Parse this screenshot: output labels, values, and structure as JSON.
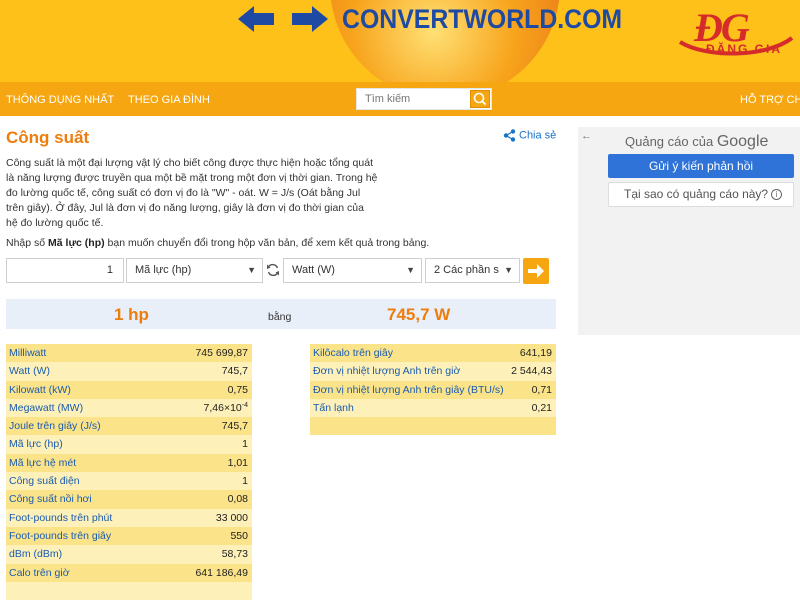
{
  "header": {
    "brand": "CONVERTWORLD.COM",
    "partner_logo_letters": "ĐG",
    "partner_logo_name": "ĐẶNG GIA"
  },
  "nav": {
    "items": [
      {
        "label": "THÔNG DỤNG NHẤT"
      },
      {
        "label": "THEO GIA ĐÌNH"
      },
      {
        "label": "HỖ TRỢ CH"
      }
    ],
    "search_placeholder": "Tìm kiếm"
  },
  "page": {
    "title": "Công suất",
    "share_label": "Chia sẻ",
    "description": "Công suất là một đại lượng vật lý cho biết công được thực hiện hoặc tổng quát là năng lượng được truyền qua một bề mặt trong một đơn vị thời gian. Trong hệ đo lường quốc tế, công suất có đơn vị đo là \"W\" - oát. W = J/s (Oát bằng Jul trên giây). Ở đây, Jul là đơn vị đo năng lượng, giây là đơn vị đo thời gian của hệ đo lường quốc tế.",
    "instruction_pre": "Nhập số ",
    "instruction_unit": "Mã lực (hp)",
    "instruction_post": " bạn muốn chuyển đổi trong hộp văn bản, để xem kết quả trong bảng."
  },
  "converter": {
    "input_value": "1",
    "from_unit": "Mã lực (hp)",
    "to_unit": "Watt (W)",
    "precision": "2 Các phần s"
  },
  "result": {
    "left": "1 hp",
    "middle": "bằng",
    "right": "745,7 W"
  },
  "table_left": [
    {
      "name": "Milliwatt",
      "value": "745 699,87"
    },
    {
      "name": "Watt (W)",
      "value": "745,7"
    },
    {
      "name": "Kilowatt (kW)",
      "value": "0,75"
    },
    {
      "name": "Megawatt (MW)",
      "value": "7,46×10",
      "exp": "-4"
    },
    {
      "name": "Joule trên giây (J/s)",
      "value": "745,7"
    },
    {
      "name": "Mã lực (hp)",
      "value": "1"
    },
    {
      "name": "Mã lực hệ mét",
      "value": "1,01"
    },
    {
      "name": "Công suất điện",
      "value": "1"
    },
    {
      "name": "Công suất nồi hơi",
      "value": "0,08"
    },
    {
      "name": "Foot-pounds trên phút",
      "value": "33 000"
    },
    {
      "name": "Foot-pounds trên giây",
      "value": "550"
    },
    {
      "name": "dBm (dBm)",
      "value": "58,73"
    },
    {
      "name": "Calo trên giờ",
      "value": "641 186,49"
    },
    {
      "name": "",
      "value": ""
    }
  ],
  "table_right": [
    {
      "name": "Kilôcalo trên giây",
      "value": "641,19"
    },
    {
      "name": "Đơn vị nhiệt lượng Anh trên giờ",
      "value": "2 544,43"
    },
    {
      "name": "Đơn vị nhiệt lượng Anh trên giây (BTU/s)",
      "value": "0,71"
    },
    {
      "name": "Tấn lạnh",
      "value": "0,21"
    },
    {
      "name": "",
      "value": ""
    }
  ],
  "ad": {
    "by_label": "Quảng cáo của",
    "by_brand": "Google",
    "feedback_button": "Gửi ý kiến phản hồi",
    "why_button": "Tại sao có quảng cáo này?"
  },
  "colors": {
    "header_yellow": "#fdc11a",
    "nav_orange": "#f6a610",
    "title_orange": "#ee7d0c",
    "brand_blue": "#1e4aa3",
    "link_blue": "#1a5cb0",
    "row_odd": "#fbe38a",
    "row_even": "#fdf0b8",
    "result_bg": "#e9eff9",
    "logo_red": "#d52b2b"
  }
}
